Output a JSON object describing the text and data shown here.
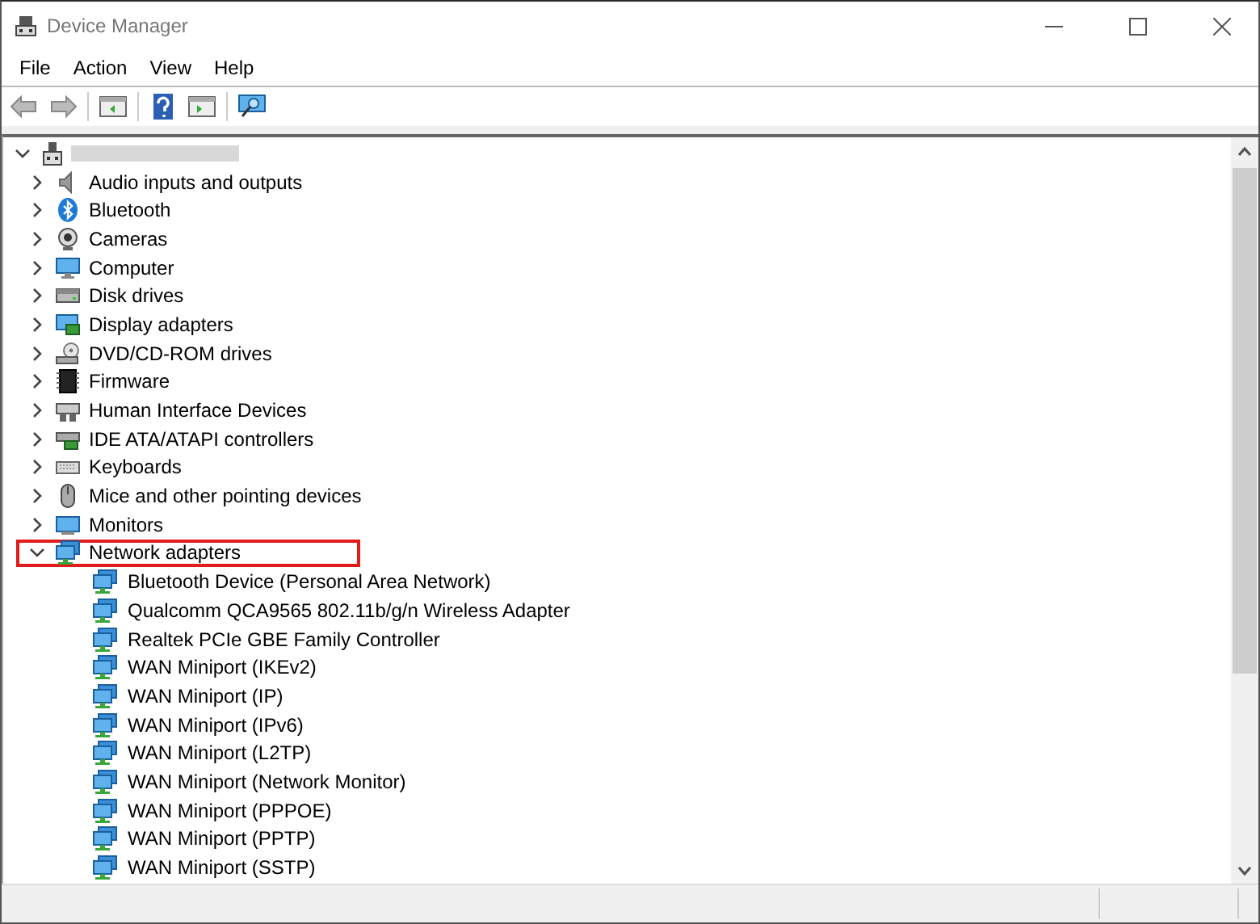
{
  "window": {
    "title": "Device Manager"
  },
  "menu": [
    "File",
    "Action",
    "View",
    "Help"
  ],
  "tree": {
    "expanded": true,
    "categories": [
      {
        "label": "Audio inputs and outputs",
        "expanded": false,
        "highlighted": false
      },
      {
        "label": "Bluetooth",
        "expanded": false,
        "highlighted": false
      },
      {
        "label": "Cameras",
        "expanded": false,
        "highlighted": false
      },
      {
        "label": "Computer",
        "expanded": false,
        "highlighted": false
      },
      {
        "label": "Disk drives",
        "expanded": false,
        "highlighted": false
      },
      {
        "label": "Display adapters",
        "expanded": false,
        "highlighted": false
      },
      {
        "label": "DVD/CD-ROM drives",
        "expanded": false,
        "highlighted": false
      },
      {
        "label": "Firmware",
        "expanded": false,
        "highlighted": false
      },
      {
        "label": "Human Interface Devices",
        "expanded": false,
        "highlighted": false
      },
      {
        "label": "IDE ATA/ATAPI controllers",
        "expanded": false,
        "highlighted": false
      },
      {
        "label": "Keyboards",
        "expanded": false,
        "highlighted": false
      },
      {
        "label": "Mice and other pointing devices",
        "expanded": false,
        "highlighted": false
      },
      {
        "label": "Monitors",
        "expanded": false,
        "highlighted": false
      },
      {
        "label": "Network adapters",
        "expanded": true,
        "highlighted": true,
        "children": [
          {
            "label": "Bluetooth Device (Personal Area Network)"
          },
          {
            "label": "Qualcomm QCA9565 802.11b/g/n Wireless Adapter"
          },
          {
            "label": "Realtek PCIe GBE Family Controller"
          },
          {
            "label": "WAN Miniport (IKEv2)"
          },
          {
            "label": "WAN Miniport (IP)"
          },
          {
            "label": "WAN Miniport (IPv6)"
          },
          {
            "label": "WAN Miniport (L2TP)"
          },
          {
            "label": "WAN Miniport (Network Monitor)"
          },
          {
            "label": "WAN Miniport (PPPOE)"
          },
          {
            "label": "WAN Miniport (PPTP)"
          },
          {
            "label": "WAN Miniport (SSTP)"
          }
        ]
      }
    ]
  }
}
